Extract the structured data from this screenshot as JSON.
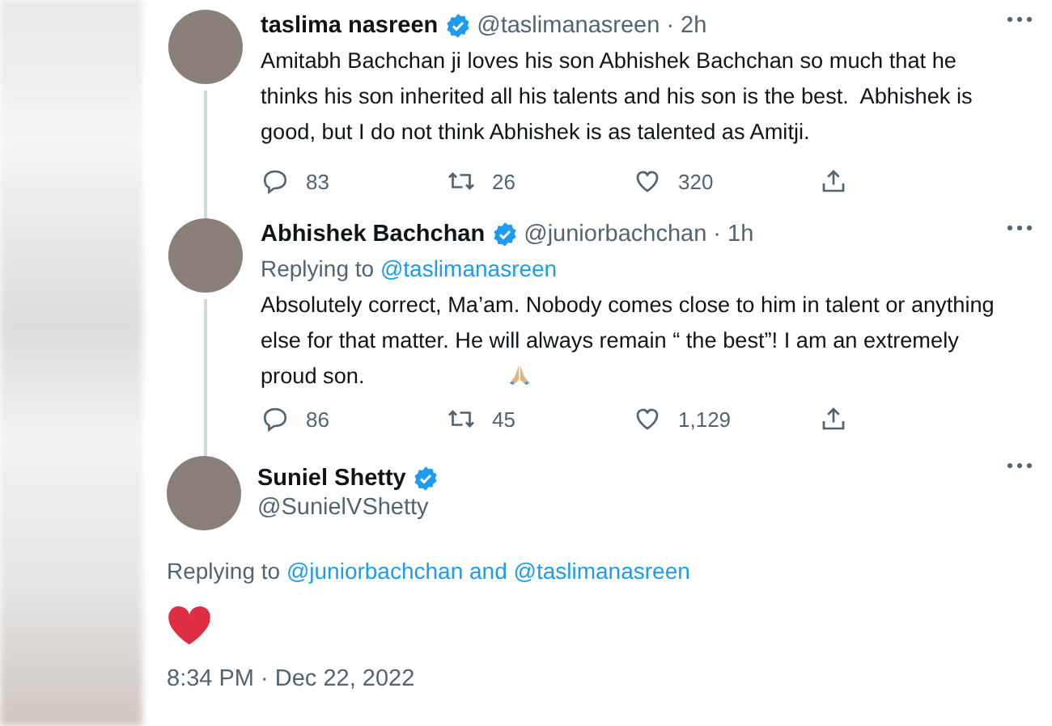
{
  "tweets": [
    {
      "kind": "thread",
      "name": "taslima nasreen",
      "verified": true,
      "handle": "@taslimanasreen",
      "time": "· 2h",
      "text": "Amitabh Bachchan ji loves his son Abhishek Bachchan so much that he thinks his son inherited all his talents and his son is the best.  Abhishek is good, but I do not think Abhishek is as talented as Amitji.",
      "stats": {
        "replies": "83",
        "retweets": "26",
        "likes": "320"
      }
    },
    {
      "kind": "thread",
      "name": "Abhishek Bachchan",
      "verified": true,
      "handle": "@juniorbachchan",
      "time": "· 1h",
      "replying": {
        "label": "Replying to",
        "target": "@taslimanasreen"
      },
      "text": "Absolutely correct, Ma’am. Nobody comes close to him in talent or anything else for that matter. He will always remain “ the best”! I am an extremely proud son.",
      "emoji": true,
      "stats": {
        "replies": "86",
        "retweets": "45",
        "likes": "1,129"
      }
    },
    {
      "kind": "focused",
      "name": "Suniel Shetty",
      "verified": true,
      "handle": "@SunielVShetty",
      "replying": {
        "label": "Replying to",
        "target": "@juniorbachchan and @taslimanasreen"
      },
      "timestamp": "8:34 PM · Dec 22, 2022"
    }
  ]
}
